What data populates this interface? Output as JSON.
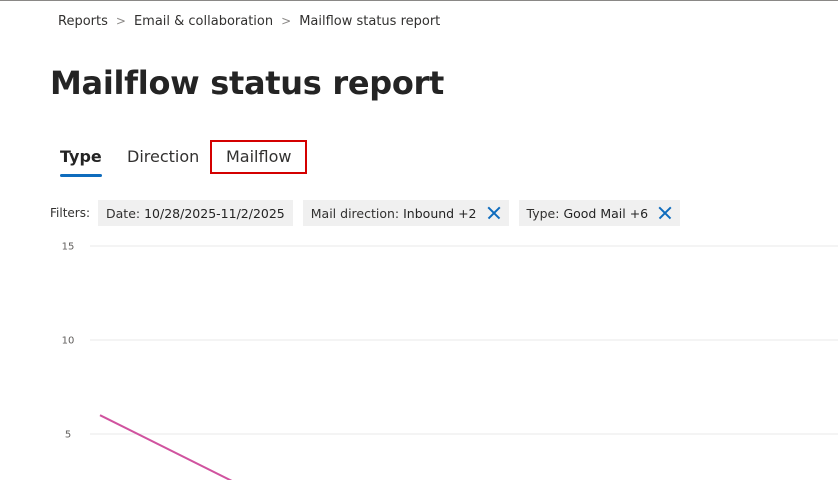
{
  "breadcrumb": {
    "items": [
      "Reports",
      "Email & collaboration",
      "Mailflow status report"
    ],
    "separator": ">"
  },
  "page_title": "Mailflow status report",
  "tabs": [
    {
      "label": "Type",
      "active": true
    },
    {
      "label": "Direction",
      "active": false
    },
    {
      "label": "Mailflow",
      "active": false,
      "highlighted": true
    }
  ],
  "filters": {
    "label": "Filters:",
    "chips": [
      {
        "prefix": "Date:",
        "value": "10/28/2025-11/2/2025",
        "removable": false
      },
      {
        "prefix": "Mail direction:",
        "value": "Inbound +2",
        "removable": true
      },
      {
        "prefix": "Type:",
        "value": "Good Mail +6",
        "removable": true
      }
    ]
  },
  "colors": {
    "accent": "#0f6cbd",
    "highlight_border": "#d40000",
    "series_line": "#d0539f",
    "grid": "#e8e8e8"
  },
  "chart_data": {
    "type": "line",
    "y_ticks": [
      "15",
      "10",
      "5"
    ],
    "ylim": [
      0,
      15
    ],
    "grid": true,
    "series": [
      {
        "values": [
          6,
          2.5
        ]
      }
    ]
  }
}
